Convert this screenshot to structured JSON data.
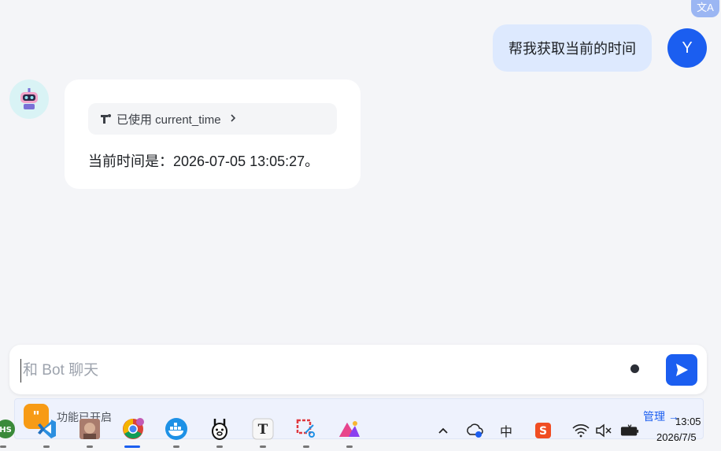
{
  "translate": {
    "glyph": "文A"
  },
  "user_message": {
    "text": "帮我获取当前的时间",
    "avatar_letter": "Y"
  },
  "bot_message": {
    "tool_chip": {
      "label": "已使用 current_time"
    },
    "text": "当前时间是：2026-07-05 13:05:27。"
  },
  "composer": {
    "placeholder": "和 Bot 聊天"
  },
  "feature_bar": {
    "label": "功能已开启",
    "manage": "管理"
  },
  "taskbar": {
    "apps": [
      "hs-app-icon",
      "vscode-icon",
      "photo-app-icon",
      "chrome-icon",
      "docker-icon",
      "ollama-icon",
      "typora-icon",
      "snipping-tool-icon",
      "arc-app-icon"
    ],
    "tray": {
      "ime": "中",
      "time": "13:05",
      "date": "2026/7/5"
    }
  },
  "colors": {
    "accent": "#1b5ef0",
    "user_bubble": "#dde9fe",
    "feature_orange": "#f79b16"
  }
}
